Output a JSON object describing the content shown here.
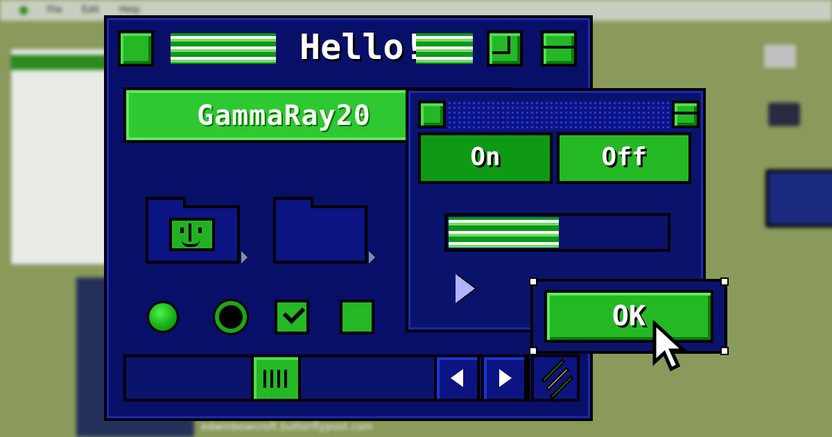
{
  "window": {
    "title": "Hello!"
  },
  "text_field": {
    "value": "GammaRay20"
  },
  "dialog": {
    "toggle_on": "On",
    "toggle_off": "Off",
    "progress_fraction": 0.5
  },
  "ok_button": {
    "label": "OK"
  },
  "scrollbar": {
    "thumb_fraction": 0.4
  },
  "background_desktop": {
    "menu": [
      "File",
      "Edit",
      "Help"
    ],
    "footer": "edwinbowcroft.butterflypost.com"
  },
  "icons": [
    "finder-face-icon",
    "folder-icon",
    "arrow-left-icon",
    "arrow-right-icon",
    "resize-grip-icon",
    "cursor-icon",
    "pointer-icon"
  ],
  "colors": {
    "window_bg": "#080f68",
    "accent_green": "#25b825",
    "border": "#000000",
    "desktop": "#8a9a5a"
  }
}
